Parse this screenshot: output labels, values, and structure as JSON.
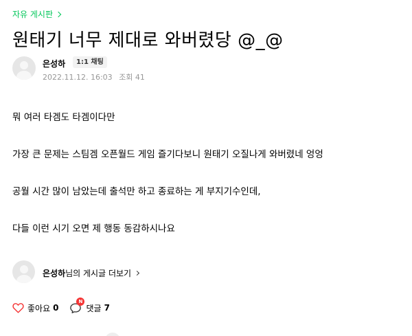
{
  "board": {
    "name": "자유 게시판"
  },
  "post": {
    "title": "원태기 너무 제대로 와버렸당 @_@",
    "author": "은성하",
    "chat_label": "1:1 채팅",
    "date": "2022.11.12. 16:03",
    "views_label": "조회 41",
    "paragraphs": [
      "뭐 여러 타겜도 타겜이다만",
      "가장 큰 문제는 스팀겜 오픈월드 게임 즐기다보니 원태기 오질나게 와버렸네 엉엉",
      "공월 시간 많이 남았는데 출석만 하고 종료하는 게 부지기수인데,",
      "다들 이런 시기 오면 제 행동 동감하시나요"
    ]
  },
  "author_box": {
    "name": "은성하",
    "suffix": "님의 게시글 더보기"
  },
  "actions": {
    "like_label": "좋아요",
    "like_count": "0",
    "comment_label": "댓글",
    "comment_count": "7",
    "comment_badge": "N"
  },
  "colors": {
    "accent": "#03c75a",
    "heart": "#f53535",
    "badge": "#f53535",
    "meta": "#979797"
  },
  "icons": [
    "chevron-right-icon",
    "avatar-placeholder-icon",
    "heart-icon",
    "comment-icon"
  ]
}
